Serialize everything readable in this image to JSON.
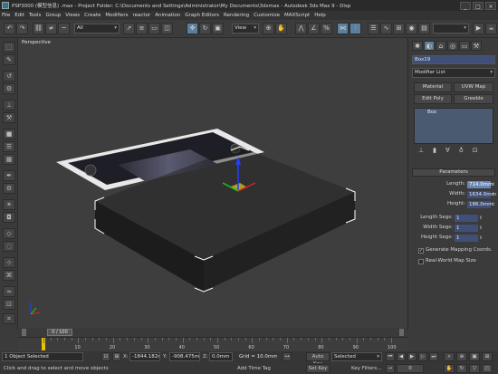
{
  "titlebar": {
    "title": "PSP3000 (模型信息) .max  - Project Folder: C:\\Documents and Settings\\Administrator\\My Documents\\3dsmax  - Autodesk 3ds Max 9 - Disp",
    "minimize": "_",
    "maximize": "□",
    "close": "×"
  },
  "menu": [
    "File",
    "Edit",
    "Tools",
    "Group",
    "Views",
    "Create",
    "Modifiers",
    "reactor",
    "Animation",
    "Graph Editors",
    "Rendering",
    "Customize",
    "MAXScript",
    "Help"
  ],
  "toolbar": {
    "selection_filter": "All",
    "ref_coord": "View"
  },
  "viewport": {
    "label": "Perspective"
  },
  "command_panel": {
    "object_name": "Box19",
    "modifier_list": "Modifier List",
    "buttons": [
      "Material",
      "UVW Map",
      "Edit Poly",
      "Greeble"
    ],
    "stack_item": "Box",
    "params_title": "Parameters",
    "params": [
      {
        "label": "Length:",
        "value": "714.0mm"
      },
      {
        "label": "Width:",
        "value": "1634.0mm"
      },
      {
        "label": "Height:",
        "value": "186.0mm"
      }
    ],
    "segs": [
      {
        "label": "Length Segs:",
        "value": "1"
      },
      {
        "label": "Width Segs:",
        "value": "1"
      },
      {
        "label": "Height Segs:",
        "value": "1"
      }
    ],
    "gen_mapping": "Generate Mapping Coords.",
    "real_world": "Real-World Map Size",
    "gen_mapping_checked": true,
    "real_world_checked": false
  },
  "time": {
    "counter": "0 / 100",
    "ticks": [
      "10",
      "20",
      "30",
      "40",
      "50",
      "60",
      "70",
      "80",
      "90",
      "100"
    ]
  },
  "status": {
    "selected": "1 Object Selected",
    "prompt": "Click and drag to select and move objects",
    "x_label": "X:",
    "x": "-1844.182r",
    "y_label": "Y:",
    "y": "-908.475mi",
    "z_label": "Z:",
    "z": "0.0mm",
    "grid": "Grid = 10.0mm",
    "add_time_tag": "Add Time Tag",
    "auto_key": "Auto Key",
    "selected_dd": "Selected",
    "set_key": "Set Key",
    "key_filters": "Key Filters..."
  },
  "colors": {
    "active_spinner": "#6b86b6",
    "box_wire": "#ffffff",
    "gizmo_x": "#e02020",
    "gizmo_y": "#20c020",
    "gizmo_z": "#2040ff",
    "gizmo_plane": "#e0d020"
  }
}
